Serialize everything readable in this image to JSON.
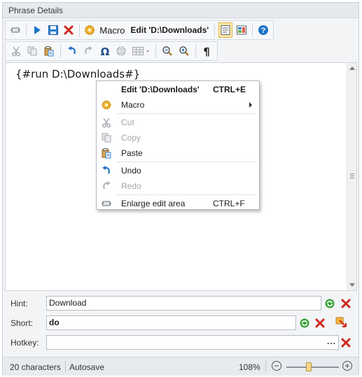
{
  "panel": {
    "title": "Phrase Details"
  },
  "toolbar1": {
    "items": [
      {
        "icon": "enlarge-icon"
      },
      {
        "icon": "play-icon"
      },
      {
        "icon": "save-icon"
      },
      {
        "icon": "delete-icon"
      },
      {
        "icon": "gear-icon"
      }
    ],
    "macro_label": "Macro",
    "edit_label": "Edit 'D:\\Downloads'",
    "view_buttons": [
      {
        "icon": "text-view-icon",
        "active": true
      },
      {
        "icon": "designer-view-icon",
        "active": false
      },
      {
        "icon": "help-icon",
        "active": false
      }
    ]
  },
  "toolbar2": {
    "items": [
      {
        "icon": "cut-icon",
        "disabled": true
      },
      {
        "icon": "copy-icon",
        "disabled": true
      },
      {
        "icon": "paste-icon",
        "disabled": false
      },
      {
        "icon": "undo-icon",
        "disabled": false
      },
      {
        "icon": "redo-icon",
        "disabled": true
      },
      {
        "icon": "omega-icon",
        "disabled": false
      },
      {
        "icon": "web-icon",
        "disabled": true
      },
      {
        "icon": "table-icon",
        "disabled": true
      },
      {
        "icon": "zoom-out-icon",
        "disabled": false
      },
      {
        "icon": "zoom-in-icon",
        "disabled": false
      },
      {
        "icon": "pilcrow-icon",
        "disabled": false
      }
    ]
  },
  "editor": {
    "content": "{#run D:\\Downloads#}"
  },
  "context_menu": {
    "items": [
      {
        "label": "Edit 'D:\\Downloads'",
        "shortcut": "CTRL+E",
        "bold": true,
        "disabled": false,
        "icon": ""
      },
      {
        "label": "Macro",
        "shortcut": "",
        "bold": false,
        "disabled": false,
        "icon": "gear-icon",
        "submenu": true
      },
      {
        "label": "Cut",
        "shortcut": "",
        "bold": false,
        "disabled": true,
        "icon": "cut-icon"
      },
      {
        "label": "Copy",
        "shortcut": "",
        "bold": false,
        "disabled": true,
        "icon": "copy-icon"
      },
      {
        "label": "Paste",
        "shortcut": "",
        "bold": false,
        "disabled": false,
        "icon": "paste-icon"
      },
      {
        "label": "Undo",
        "shortcut": "",
        "bold": false,
        "disabled": false,
        "icon": "undo-icon"
      },
      {
        "label": "Redo",
        "shortcut": "",
        "bold": false,
        "disabled": true,
        "icon": "redo-icon"
      },
      {
        "label": "Enlarge edit area",
        "shortcut": "CTRL+F",
        "bold": false,
        "disabled": false,
        "icon": "enlarge-icon"
      }
    ]
  },
  "fields": {
    "hint": {
      "label": "Hint:",
      "value": "Download"
    },
    "short": {
      "label": "Short:",
      "value": "do"
    },
    "hotkey": {
      "label": "Hotkey:",
      "value": "",
      "browse": "..."
    }
  },
  "status": {
    "characters": "20 characters",
    "autosave": "Autosave",
    "zoom": "108%",
    "zoom_level": 0.43
  },
  "colors": {
    "accent_blue": "#1e74c9",
    "delete_red": "#d0271d",
    "active_button": "#fde9a8"
  }
}
